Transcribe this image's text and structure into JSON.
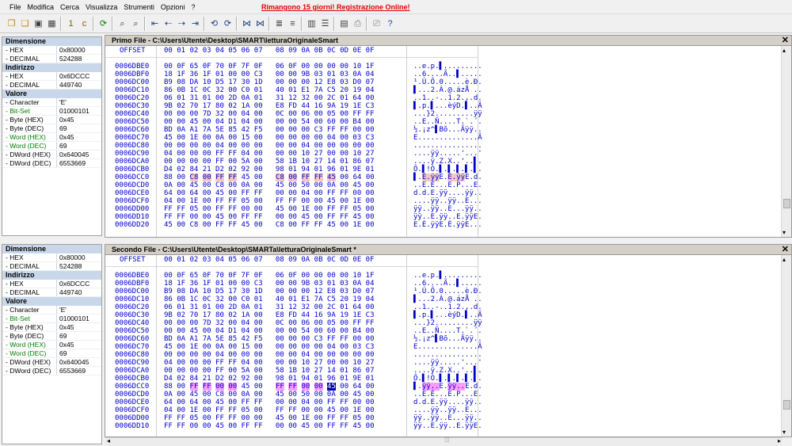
{
  "menu": [
    "File",
    "Modifica",
    "Cerca",
    "Visualizza",
    "Strumenti",
    "Opzioni",
    "?"
  ],
  "promo": "Rimangono 15 giorni!   Registrazione Online!",
  "toolbar_icons": [
    "new-file-icon",
    "open-file-icon",
    "save-icon",
    "save-all-icon",
    "bookmark-1-icon",
    "bookmark-c-icon",
    "refresh-icon",
    "find-icon",
    "find-next-icon",
    "goto-start-icon",
    "goto-prev-icon",
    "goto-next-icon",
    "goto-end-icon",
    "sync-prev-icon",
    "sync-next-icon",
    "compare-icon",
    "compare-next-icon",
    "align-left-icon",
    "align-right-icon",
    "column-icon",
    "list-icon",
    "document-icon",
    "print-icon",
    "print-preview-icon",
    "help-icon"
  ],
  "panel1": {
    "title": "Primo File - C:\\Users\\Utente\\Desktop\\SMART\\letturaOriginaleSmart",
    "info": [
      {
        "group": "Dimensione",
        "rows": [
          [
            "- HEX",
            "0x80000",
            ""
          ],
          [
            "- DECIMAL",
            "524288",
            ""
          ]
        ]
      },
      {
        "group": "Indirizzo",
        "rows": [
          [
            "- HEX",
            "0x6DCCC",
            ""
          ],
          [
            "- DECIMAL",
            "449740",
            ""
          ]
        ]
      },
      {
        "group": "Valore",
        "rows": [
          [
            "- Character",
            "'E'",
            ""
          ],
          [
            "- Bit-Set",
            "01000101",
            "g"
          ],
          [
            "- Byte (HEX)",
            "0x45",
            ""
          ],
          [
            "- Byte (DEC)",
            "69",
            ""
          ],
          [
            "- Word (HEX)",
            "0x45",
            "g"
          ],
          [
            "- Word (DEC)",
            "69",
            "g"
          ],
          [
            "- DWord (HEX)",
            "0x640045",
            ""
          ],
          [
            "- DWord (DEC)",
            "6553669",
            ""
          ]
        ]
      }
    ]
  },
  "panel2": {
    "title": "Secondo File - C:\\Users\\Utente\\Desktop\\SMARTa\\letturaOriginaleSmart *",
    "info": [
      {
        "group": "Dimensione",
        "rows": [
          [
            "- HEX",
            "0x80000",
            ""
          ],
          [
            "- DECIMAL",
            "524288",
            ""
          ]
        ]
      },
      {
        "group": "Indirizzo",
        "rows": [
          [
            "- HEX",
            "0x6DCCC",
            ""
          ],
          [
            "- DECIMAL",
            "449740",
            ""
          ]
        ]
      },
      {
        "group": "Valore",
        "rows": [
          [
            "- Character",
            "'E'",
            ""
          ],
          [
            "- Bit-Set",
            "01000101",
            "g"
          ],
          [
            "- Byte (HEX)",
            "0x45",
            ""
          ],
          [
            "- Byte (DEC)",
            "69",
            ""
          ],
          [
            "- Word (HEX)",
            "0x45",
            "g"
          ],
          [
            "- Word (DEC)",
            "69",
            "g"
          ],
          [
            "- DWord (HEX)",
            "0x640045",
            ""
          ],
          [
            "- DWord (DEC)",
            "6553669",
            ""
          ]
        ]
      }
    ]
  },
  "hex_header": {
    "offset": "OFFSET",
    "cols": "00 01 02 03 04 05 06 07   08 09 0A 0B 0C 0D 0E 0F"
  },
  "hex1": [
    [
      "0006DBE0",
      "00 0F 65 0F 70 0F 7F 0F   06 0F 00 00 00 00 10 1F",
      "..e.p.▌........."
    ],
    [
      "0006DBF0",
      "18 1F 36 1F 01 00 00 C3   00 00 9B 03 01 03 0A 04",
      "..6....Ã..▌....."
    ],
    [
      "0006DC00",
      "B9 08 DA 10 D5 17 30 1D   00 00 00 12 E8 03 D0 07",
      "¹.Ú.Õ.0.....è.Ð."
    ],
    [
      "0006DC10",
      "86 0B 1C 0C 32 00 C0 01   40 01 E1 7A C5 20 19 04",
      "▌...2.À.@.ázÅ .."
    ],
    [
      "0006DC20",
      "06 01 31 01 00 2D 0A 01   31 12 32 00 2C 01 64 00",
      "..1..-..1.2.,.d."
    ],
    [
      "0006DC30",
      "9B 02 70 17 80 02 1A 00   E8 FD 44 16 9A 19 1E C3",
      "▌.p.▌...èýD.▌..Ã"
    ],
    [
      "0006DC40",
      "00 00 00 7D 32 00 04 00   0C 00 06 00 05 00 FF FF",
      "...}2.........ÿÿ"
    ],
    [
      "0006DC50",
      "00 00 45 00 04 D1 04 00   00 00 54 00 60 00 B4 00",
      "..E..Ñ....T.`.´."
    ],
    [
      "0006DC60",
      "BD 0A A1 7A 5E 85 42 F5   00 00 00 C3 FF FF 00 00",
      "½.¡z^▌Bõ...Ãÿÿ.."
    ],
    [
      "0006DC70",
      "45 00 1E 00 0A 00 15 00   00 00 00 00 04 00 03 C3",
      "E..............Ã"
    ],
    [
      "0006DC80",
      "00 00 00 00 04 00 00 00   00 00 04 00 00 00 00 00",
      "................"
    ],
    [
      "0006DC90",
      "04 00 00 00 FF FF 04 00   00 00 10 27 00 00 10 27",
      "....ÿÿ.....'...'"
    ],
    [
      "0006DCA0",
      "00 00 00 00 FF 00 5A 00   58 1B 10 27 14 01 86 07",
      "....ÿ.Z.X..'..▌."
    ],
    [
      "0006DCB0",
      "D4 02 84 21 D2 02 92 00   98 01 94 01 96 01 9E 01",
      "Ô.▌!Ò.▌.▌.▌.▌.▌."
    ],
    [
      "0006DCC0",
      "88 00 C8 00 FF FF 45 00   C8 00 FF FF 45 00 64 00",
      "▌.È.ÿÿE.È.ÿÿE.d."
    ],
    [
      "0006DCD0",
      "0A 00 45 00 C8 00 0A 00   45 00 50 00 0A 00 45 00",
      "..E.È...E.P...E."
    ],
    [
      "0006DCE0",
      "64 00 64 00 45 00 FF FF   00 00 04 00 FF FF 00 00",
      "d.d.E.ÿÿ....ÿÿ.."
    ],
    [
      "0006DCF0",
      "04 00 1E 00 FF FF 05 00   FF FF 00 00 45 00 1E 00",
      "....ÿÿ..ÿÿ..E..."
    ],
    [
      "0006DD00",
      "FF FF 05 00 FF FF 00 00   45 00 1E 00 FF FF 05 00",
      "ÿÿ..ÿÿ..E...ÿÿ.."
    ],
    [
      "0006DD10",
      "FF FF 00 00 45 00 FF FF   00 00 45 00 FF FF 45 00",
      "ÿÿ..E.ÿÿ..E.ÿÿE."
    ],
    [
      "0006DD20",
      "45 00 C8 00 FF FF 45 00   C8 00 FF FF 45 00 1E 00",
      "E.È.ÿÿE.È.ÿÿE..."
    ]
  ],
  "hex2": [
    [
      "0006DBE0",
      "00 0F 65 0F 70 0F 7F 0F   06 0F 00 00 00 00 10 1F",
      "..e.p.▌........."
    ],
    [
      "0006DBF0",
      "18 1F 36 1F 01 00 00 C3   00 00 9B 03 01 03 0A 04",
      "..6....Ã..▌....."
    ],
    [
      "0006DC00",
      "B9 08 DA 10 D5 17 30 1D   00 00 00 12 E8 03 D0 07",
      "¹.Ú.Õ.0.....è.Ð."
    ],
    [
      "0006DC10",
      "86 0B 1C 0C 32 00 C0 01   40 01 E1 7A C5 20 19 04",
      "▌...2.À.@.ázÅ .."
    ],
    [
      "0006DC20",
      "06 01 31 01 00 2D 0A 01   31 12 32 00 2C 01 64 00",
      "..1..-..1.2.,.d."
    ],
    [
      "0006DC30",
      "9B 02 70 17 80 02 1A 00   E8 FD 44 16 9A 19 1E C3",
      "▌.p.▌...èýD.▌..Ã"
    ],
    [
      "0006DC40",
      "00 00 00 7D 32 00 04 00   0C 00 06 00 05 00 FF FF",
      "...}2.........ÿÿ"
    ],
    [
      "0006DC50",
      "00 00 45 00 04 D1 04 00   00 00 54 00 60 00 B4 00",
      "..E..Ñ....T.`.´."
    ],
    [
      "0006DC60",
      "BD 0A A1 7A 5E 85 42 F5   00 00 00 C3 FF FF 00 00",
      "½.¡z^▌Bõ...Ãÿÿ.."
    ],
    [
      "0006DC70",
      "45 00 1E 00 0A 00 15 00   00 00 00 00 04 00 03 C3",
      "E..............Ã"
    ],
    [
      "0006DC80",
      "00 00 00 00 04 00 00 00   00 00 04 00 00 00 00 00",
      "................"
    ],
    [
      "0006DC90",
      "04 00 00 00 FF FF 04 00   00 00 10 27 00 00 10 27",
      "....ÿÿ.....'...'"
    ],
    [
      "0006DCA0",
      "00 00 00 00 FF 00 5A 00   58 1B 10 27 14 01 86 07",
      "....ÿ.Z.X..'..▌."
    ],
    [
      "0006DCB0",
      "D4 02 84 21 D2 02 92 00   98 01 94 01 96 01 9E 01",
      "Ô.▌!Ò.▌.▌.▌.▌.▌."
    ],
    [
      "0006DCC0",
      "88 00 FF FF 00 00 45 00   FF FF 00 00 45 00 64 00",
      "▌.ÿÿ..E.ÿÿ..E.d."
    ],
    [
      "0006DCD0",
      "0A 00 45 00 C8 00 0A 00   45 00 50 00 0A 00 45 00",
      "..E.È...E.P...E."
    ],
    [
      "0006DCE0",
      "64 00 64 00 45 00 FF FF   00 00 04 00 FF FF 00 00",
      "d.d.E.ÿÿ....ÿÿ.."
    ],
    [
      "0006DCF0",
      "04 00 1E 00 FF FF 05 00   FF FF 00 00 45 00 1E 00",
      "....ÿÿ..ÿÿ..E..."
    ],
    [
      "0006DD00",
      "FF FF 05 00 FF FF 00 00   45 00 1E 00 FF FF 05 00",
      "ÿÿ..ÿÿ..E...ÿÿ.."
    ],
    [
      "0006DD10",
      "FF FF 00 00 45 00 FF FF   00 00 45 00 FF FF 45 00",
      "ÿÿ..E.ÿÿ..E.ÿÿE."
    ]
  ],
  "highlight_row": "0006DCC0"
}
